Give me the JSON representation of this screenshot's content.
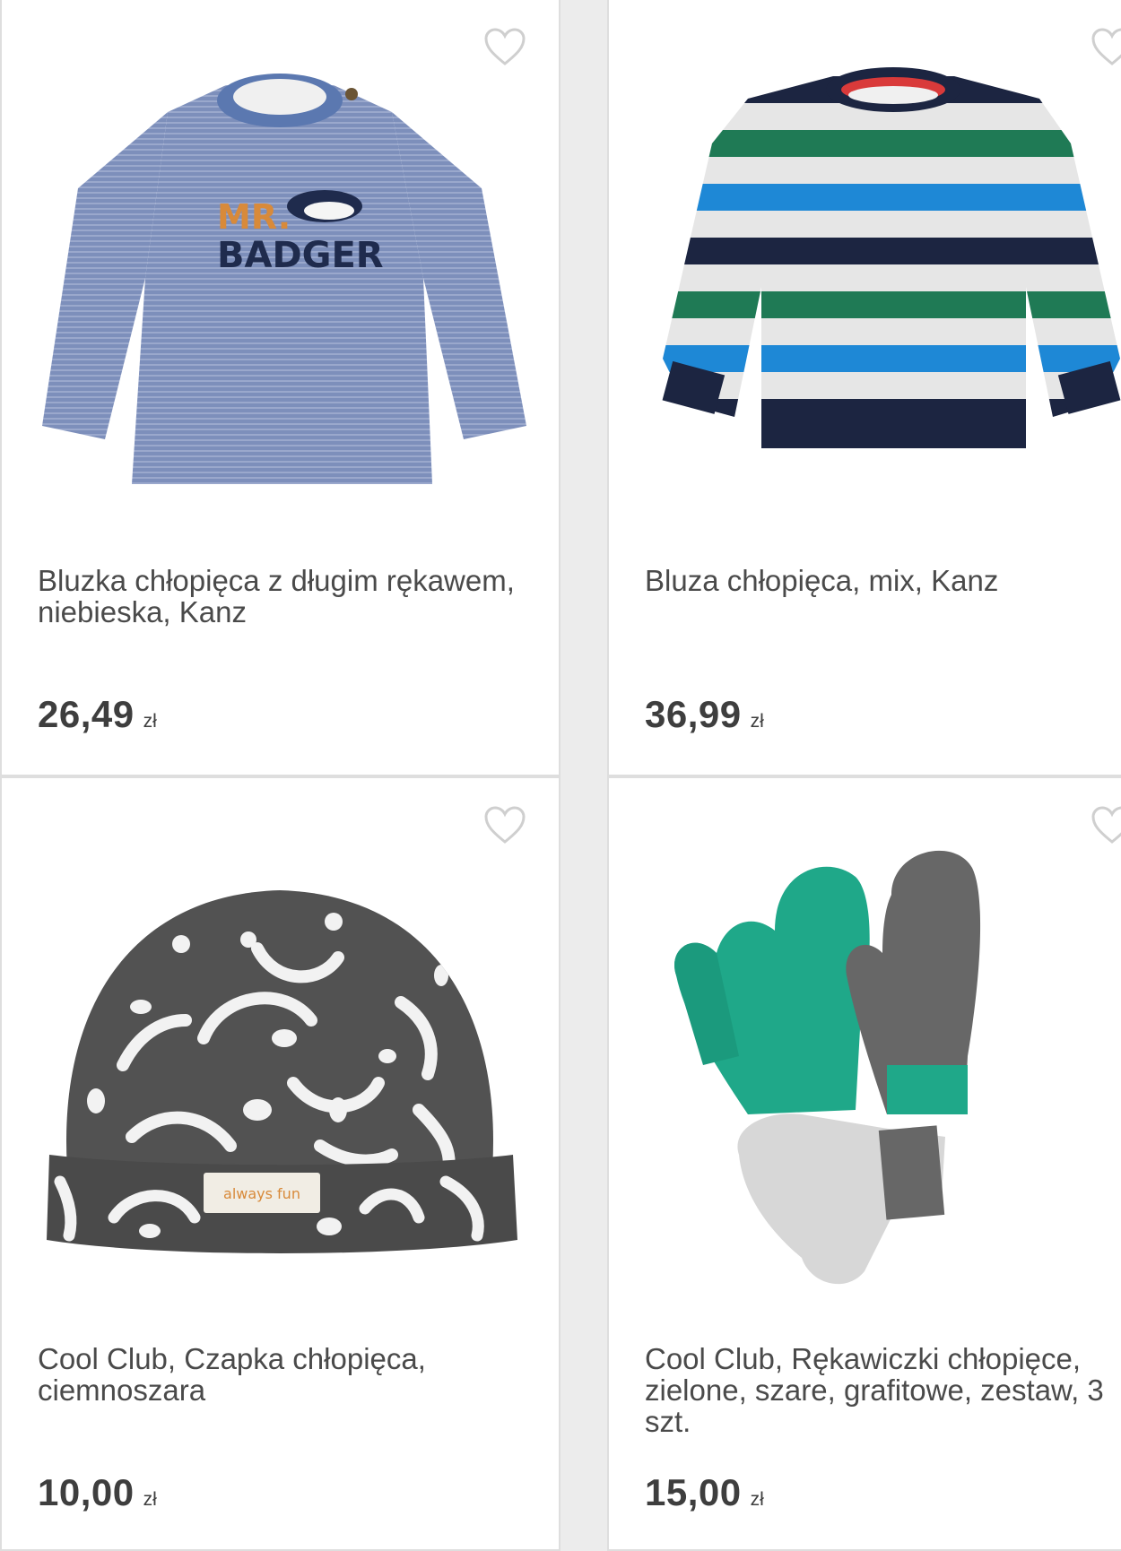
{
  "products": [
    {
      "title": "Bluzka chłopięca z długim rękawem, niebieska, Kanz",
      "price": "26,49",
      "currency": "zł",
      "print_line1": "MR.",
      "print_line2": "BADGER",
      "colors": {
        "body": "#7d8fbb",
        "collar": "#5b78b0"
      }
    },
    {
      "title": "Bluza chłopięca, mix, Kanz",
      "price": "36,99",
      "currency": "zł",
      "colors": {
        "navy": "#1c2541",
        "blue": "#1e88d6",
        "green": "#1f7a55",
        "grey": "#e6e6e6",
        "red": "#d93a3a"
      }
    },
    {
      "title": "Cool Club, Czapka chłopięca, ciemnoszara",
      "price": "10,00",
      "currency": "zł",
      "label_text": "always fun",
      "colors": {
        "fabric": "#525252",
        "pattern": "#f2f2f2"
      }
    },
    {
      "title": "Cool Club, Rękawiczki chłopięce, zielone, szare, grafitowe, zestaw, 3 szt.",
      "price": "15,00",
      "currency": "zł",
      "colors": {
        "green": "#1fa889",
        "graphite": "#676767",
        "light": "#d7d7d7"
      }
    }
  ],
  "icons": {
    "wishlist": "heart-outline-icon"
  }
}
